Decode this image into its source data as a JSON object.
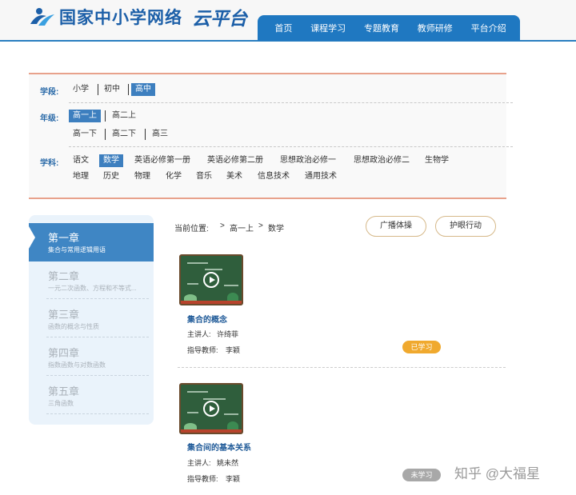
{
  "header": {
    "site_name": "国家中小学网络",
    "script_name": "云平台",
    "nav": [
      "首页",
      "课程学习",
      "专题教育",
      "教师研修",
      "平台介绍"
    ]
  },
  "filters": {
    "stage_label": "学段:",
    "stages": [
      "小学",
      "初中",
      "高中"
    ],
    "active_stage": "高中",
    "grade_label": "年级:",
    "grades_row1": [
      "高一上",
      "高二上"
    ],
    "grades_row2": [
      "高一下",
      "高二下",
      "高三"
    ],
    "active_grade": "高一上",
    "subject_label": "学科:",
    "subjects_row1": [
      "语文",
      "数学",
      "英语必修第一册",
      "英语必修第二册",
      "思想政治必修一",
      "思想政治必修二",
      "生物学"
    ],
    "subjects_row2": [
      "地理",
      "历史",
      "物理",
      "化学",
      "音乐",
      "美术",
      "信息技术",
      "通用技术"
    ],
    "active_subject": "数学"
  },
  "chapters": [
    {
      "title": "第一章",
      "subtitle": "集合与常用逻辑用语",
      "active": true
    },
    {
      "title": "第二章",
      "subtitle": "一元二次函数、方程和不等式...",
      "active": false
    },
    {
      "title": "第三章",
      "subtitle": "函数的概念与性质",
      "active": false
    },
    {
      "title": "第四章",
      "subtitle": "指数函数与对数函数",
      "active": false
    },
    {
      "title": "第五章",
      "subtitle": "三角函数",
      "active": false
    }
  ],
  "breadcrumb": {
    "label": "当前位置:",
    "sep": ">",
    "items": [
      "高一上",
      "数学"
    ]
  },
  "buttons": {
    "broadcast": "广播体操",
    "eye_care": "护眼行动"
  },
  "videos": [
    {
      "title": "集合的概念",
      "speaker_label": "主讲人:",
      "speaker": "许绮菲",
      "tutor_label": "指导教师:",
      "tutor": "李颖",
      "status": "已学习",
      "status_color": "#f0a92e"
    },
    {
      "title": "集合间的基本关系",
      "speaker_label": "主讲人:",
      "speaker": "姚未然",
      "tutor_label": "指导教师:",
      "tutor": "李颖",
      "status": "未学习",
      "status_color": "#a8a8a8"
    }
  ],
  "watermark": "知乎 @大福星",
  "colors": {
    "brand": "#1f78c1",
    "accent_border": "#e8a28c",
    "active_chip": "#3d7fbf"
  }
}
